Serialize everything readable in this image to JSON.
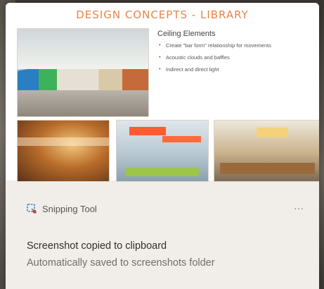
{
  "notification": {
    "app_name": "Snipping Tool",
    "app_icon": "snipping-tool-icon",
    "more_icon": "more-icon",
    "more_glyph": "···",
    "message_title": "Screenshot copied to clipboard",
    "message_body": "Automatically saved to screenshots folder"
  },
  "preview": {
    "title": "DESIGN CONCEPTS - LIBRARY",
    "heading": "Ceiling Elements",
    "bullets": [
      "Create \"bar form\" relationship for movements",
      "Acoustic clouds and baffles",
      "Indirect and direct light"
    ]
  },
  "colors": {
    "accent_title": "#e6864a",
    "toast_background": "#f1eeea"
  }
}
